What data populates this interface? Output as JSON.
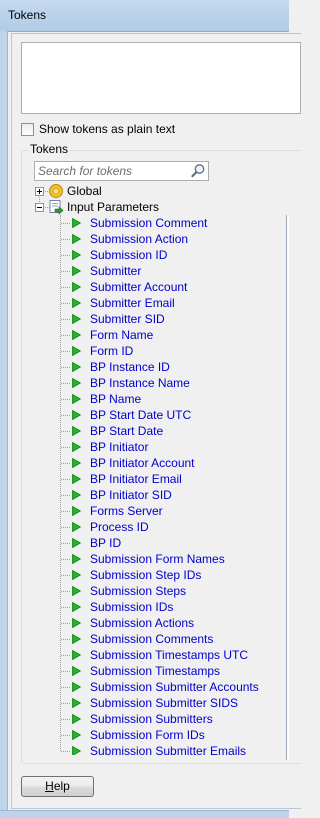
{
  "window": {
    "title": "Tokens"
  },
  "textbox": {
    "value": ""
  },
  "show_plain_text": {
    "label": "Show tokens as plain text",
    "checked": false
  },
  "tokens_group": {
    "label": "Tokens"
  },
  "search": {
    "placeholder": "Search for tokens",
    "value": ""
  },
  "tree": {
    "global": {
      "label": "Global",
      "expanded": false,
      "icon": "globe-icon"
    },
    "input_parameters": {
      "label": "Input Parameters",
      "expanded": true,
      "icon": "input-parameters-icon",
      "items": [
        "Submission Comment",
        "Submission Action",
        "Submission ID",
        "Submitter",
        "Submitter Account",
        "Submitter Email",
        "Submitter SID",
        "Form Name",
        "Form ID",
        "BP Instance ID",
        "BP Instance Name",
        "BP Name",
        "BP Start Date UTC",
        "BP Start Date",
        "BP Initiator",
        "BP Initiator Account",
        "BP Initiator Email",
        "BP Initiator SID",
        "Forms Server",
        "Process ID",
        "BP ID",
        "Submission Form Names",
        "Submission Step IDs",
        "Submission Steps",
        "Submission IDs",
        "Submission Actions",
        "Submission Comments",
        "Submission Timestamps UTC",
        "Submission Timestamps",
        "Submission Submitter Accounts",
        "Submission Submitter SIDS",
        "Submission Submitters",
        "Submission Form IDs",
        "Submission Submitter Emails"
      ]
    }
  },
  "buttons": {
    "help_label": "Help",
    "help_mnemonic": "H",
    "help_rest": "elp"
  },
  "colors": {
    "token_text": "#0000cc",
    "token_arrow": "#22b822",
    "title_bar": "#c4d9ef"
  }
}
